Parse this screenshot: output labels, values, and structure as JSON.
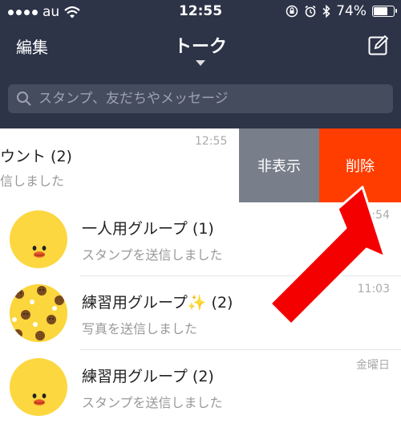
{
  "status_bar": {
    "carrier": "au",
    "time": "12:55",
    "battery": "74%",
    "battery_level": 0.74
  },
  "nav": {
    "edit_label": "編集",
    "title": "トーク"
  },
  "search": {
    "placeholder": "スタンプ、友だちやメッセージ"
  },
  "swiped_row": {
    "name": "ウント (2)",
    "message": "信しました",
    "time": "12:55",
    "hide_label": "非表示",
    "delete_label": "削除"
  },
  "chats": [
    {
      "name": "一人用グループ (1)",
      "message": "スタンプを送信しました",
      "time": "12:54"
    },
    {
      "name": "練習用グループ✨ (2)",
      "message": "写真を送信しました",
      "time": "11:03"
    },
    {
      "name": "練習用グループ (2)",
      "message": "スタンプを送信しました",
      "time": "金曜日"
    }
  ],
  "colors": {
    "header_bg": "#2d3448",
    "hide_action": "#787f8b",
    "delete_action": "#ff3d00",
    "annotation_arrow": "#f40000",
    "avatar_yellow": "#fcd73f"
  }
}
